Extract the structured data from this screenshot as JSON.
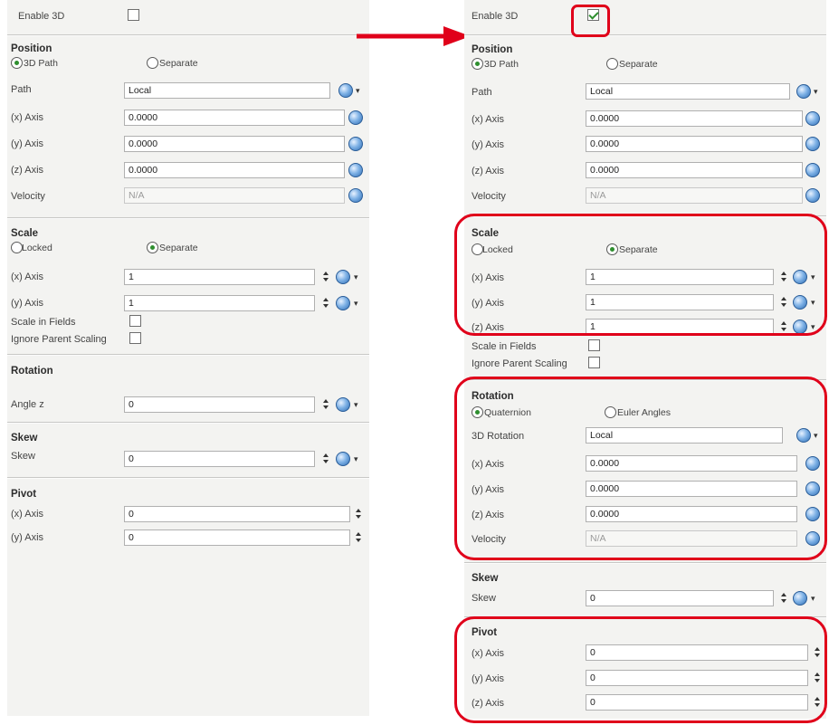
{
  "common": {
    "enable_3d": "Enable 3D",
    "position": "Position",
    "path_3d": "3D Path",
    "separate": "Separate",
    "path": "Path",
    "local": "Local",
    "x_axis": "(x) Axis",
    "y_axis": "(y) Axis",
    "z_axis": "(z) Axis",
    "velocity": "Velocity",
    "zero4": "0.0000",
    "na": "N/A",
    "scale": "Scale",
    "locked": "Locked",
    "one": "1",
    "zero": "0",
    "scale_in_fields": "Scale in Fields",
    "ignore_parent_scaling": "Ignore Parent Scaling",
    "rotation": "Rotation",
    "angle_z": "Angle z",
    "skew": "Skew",
    "pivot": "Pivot",
    "quaternion": "Quaternion",
    "euler_angles": "Euler Angles",
    "rotation_3d": "3D Rotation"
  },
  "left": {
    "enable_3d_checked": false
  },
  "right": {
    "enable_3d_checked": true
  },
  "colors": {
    "highlight": "#e0001a",
    "panel": "#f3f3f1"
  }
}
